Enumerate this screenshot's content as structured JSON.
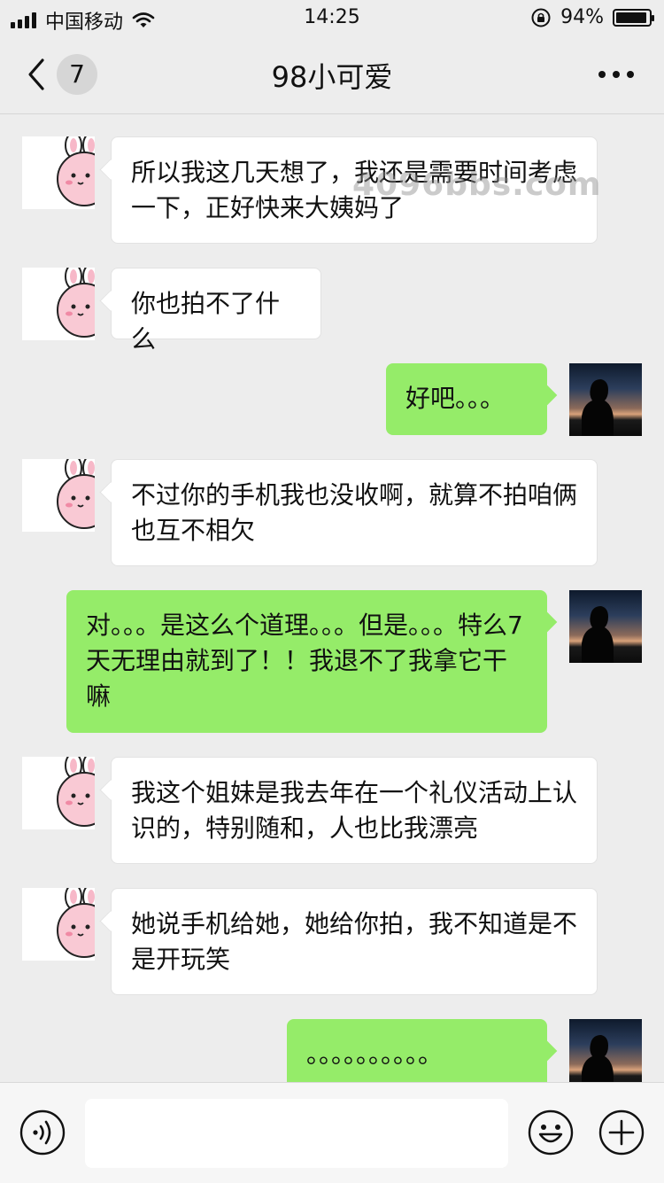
{
  "status_bar": {
    "carrier": "中国移动",
    "time": "14:25",
    "battery_percent": "94%",
    "battery_level": 0.94,
    "icons": [
      "signal-icon",
      "wifi-icon",
      "rotation-lock-icon",
      "battery-icon"
    ]
  },
  "nav": {
    "unread_count": "7",
    "title": "98小可爱",
    "icons": [
      "back-chevron-icon",
      "more-icon"
    ]
  },
  "watermark": "4096bbs.com",
  "messages": [
    {
      "side": "in",
      "avatar": "bunny-avatar",
      "text": "所以我这几天想了，我还是需要时间考虑一下，正好快来大姨妈了"
    },
    {
      "side": "in",
      "avatar": "bunny-avatar",
      "text": "你也拍不了什么"
    },
    {
      "side": "out",
      "avatar": "silhouette-photo-avatar",
      "text": "好吧。。。"
    },
    {
      "side": "in",
      "avatar": "bunny-avatar",
      "text": "不过你的手机我也没收啊，就算不拍咱俩也互不相欠"
    },
    {
      "side": "out",
      "avatar": "silhouette-photo-avatar",
      "text": "对。。。是这么个道理。。。但是。。。特么7天无理由就到了！！我退不了我拿它干嘛"
    },
    {
      "side": "in",
      "avatar": "bunny-avatar",
      "text": "我这个姐妹是我去年在一个礼仪活动上认识的，特别随和，人也比我漂亮"
    },
    {
      "side": "in",
      "avatar": "bunny-avatar",
      "text": "她说手机给她，她给你拍，我不知道是不是开玩笑"
    },
    {
      "side": "out",
      "avatar": "silhouette-photo-avatar",
      "text": "。。。。。。。。。。"
    }
  ],
  "input_bar": {
    "value": "",
    "icons": [
      "voice-icon",
      "emoji-icon",
      "plus-icon"
    ]
  },
  "colors": {
    "background": "#ededed",
    "outgoing_bubble": "#95ec69",
    "incoming_bubble": "#ffffff"
  }
}
